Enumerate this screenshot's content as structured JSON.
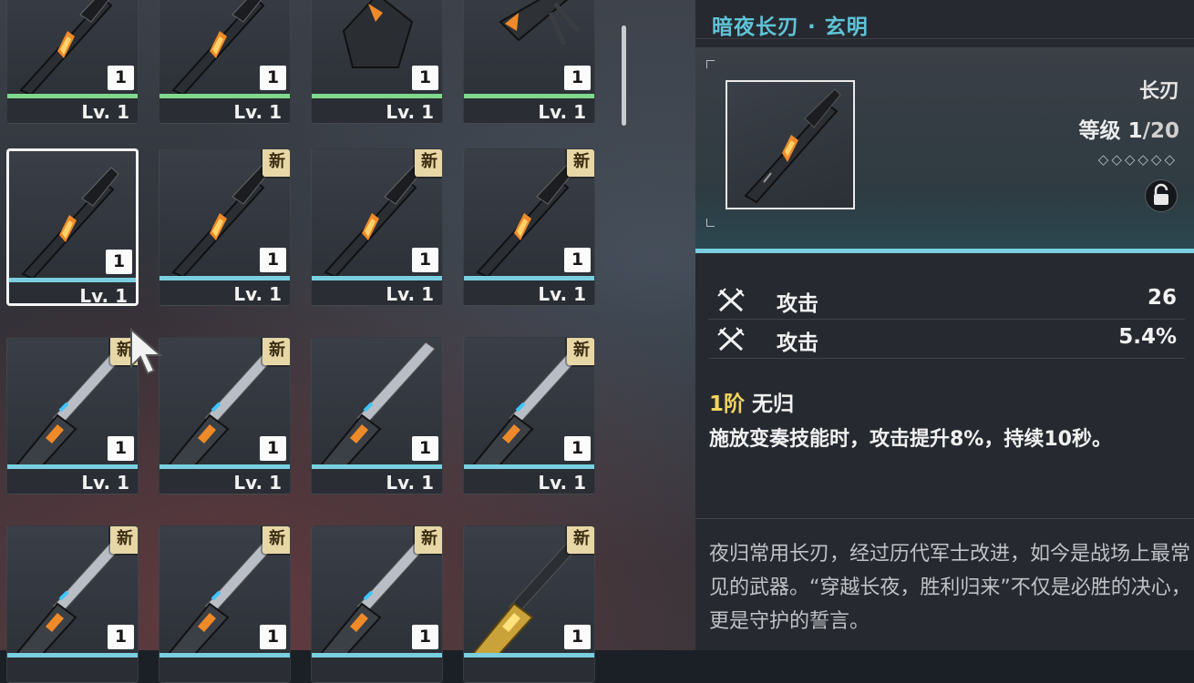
{
  "grid": {
    "cards": [
      {
        "name": "top-partial-1",
        "level": "Lv. 1",
        "qty": "1",
        "is_new": false,
        "selected": false,
        "rarity_color": "#7fd98c",
        "art": "blade"
      },
      {
        "name": "top-partial-2",
        "level": "Lv. 1",
        "qty": "1",
        "is_new": false,
        "selected": false,
        "rarity_color": "#7fd98c",
        "art": "blade"
      },
      {
        "name": "top-partial-3",
        "level": "Lv. 1",
        "qty": "1",
        "is_new": false,
        "selected": false,
        "rarity_color": "#7fd98c",
        "art": "gauntlet"
      },
      {
        "name": "top-partial-4",
        "level": "Lv. 1",
        "qty": "1",
        "is_new": false,
        "selected": false,
        "rarity_color": "#7fd98c",
        "art": "claw"
      },
      {
        "name": "row2-1",
        "level": "Lv. 1",
        "qty": "1",
        "is_new": false,
        "selected": true,
        "rarity_color": "#79cfe0",
        "art": "blade"
      },
      {
        "name": "row2-2",
        "level": "Lv. 1",
        "qty": "1",
        "is_new": true,
        "selected": false,
        "rarity_color": "#79cfe0",
        "art": "blade"
      },
      {
        "name": "row2-3",
        "level": "Lv. 1",
        "qty": "1",
        "is_new": true,
        "selected": false,
        "rarity_color": "#79cfe0",
        "art": "blade"
      },
      {
        "name": "row2-4",
        "level": "Lv. 1",
        "qty": "1",
        "is_new": true,
        "selected": false,
        "rarity_color": "#79cfe0",
        "art": "blade"
      },
      {
        "name": "row3-1",
        "level": "Lv. 1",
        "qty": "1",
        "is_new": true,
        "selected": false,
        "rarity_color": "#79cfe0",
        "art": "sword"
      },
      {
        "name": "row3-2",
        "level": "Lv. 1",
        "qty": "1",
        "is_new": true,
        "selected": false,
        "rarity_color": "#79cfe0",
        "art": "sword"
      },
      {
        "name": "row3-3",
        "level": "Lv. 1",
        "qty": "1",
        "is_new": false,
        "selected": false,
        "rarity_color": "#79cfe0",
        "art": "sword"
      },
      {
        "name": "row3-4",
        "level": "Lv. 1",
        "qty": "1",
        "is_new": true,
        "selected": false,
        "rarity_color": "#79cfe0",
        "art": "sword"
      },
      {
        "name": "row4-1",
        "level": "",
        "qty": "1",
        "is_new": true,
        "selected": false,
        "rarity_color": "#79cfe0",
        "art": "sword"
      },
      {
        "name": "row4-2",
        "level": "",
        "qty": "1",
        "is_new": true,
        "selected": false,
        "rarity_color": "#79cfe0",
        "art": "sword"
      },
      {
        "name": "row4-3",
        "level": "",
        "qty": "1",
        "is_new": true,
        "selected": false,
        "rarity_color": "#79cfe0",
        "art": "sword"
      },
      {
        "name": "row4-4",
        "level": "",
        "qty": "1",
        "is_new": true,
        "selected": false,
        "rarity_color": "#79cfe0",
        "art": "gold-sword"
      }
    ],
    "new_badge_label": "新"
  },
  "detail": {
    "title": "暗夜长刃 · 玄明",
    "weapon_type": "长刃",
    "level_label": "等级",
    "level_current": "1",
    "level_max": "/20",
    "rank_diamonds": "◇◇◇◇◇◇",
    "stats": [
      {
        "icon": "crossed-swords-icon",
        "name": "攻击",
        "value": "26"
      },
      {
        "icon": "crossed-swords-icon",
        "name": "攻击",
        "value": "5.4%"
      }
    ],
    "passive": {
      "rank": "1阶",
      "name": "无归",
      "description": "施放变奏技能时，攻击提升8%，持续10秒。"
    },
    "lore": "夜归常用长刃，经过历代军士改进，如今是战场上最常见的武器。“穿越长夜，胜利归来”不仅是必胜的决心，更是守护的誓言。"
  },
  "colors": {
    "accent_cyan": "#79cfe0",
    "title_cyan": "#5fc4d8",
    "rarity_green": "#7fd98c",
    "rank_gold": "#f2d45f",
    "new_badge": "#e8d7a6"
  }
}
